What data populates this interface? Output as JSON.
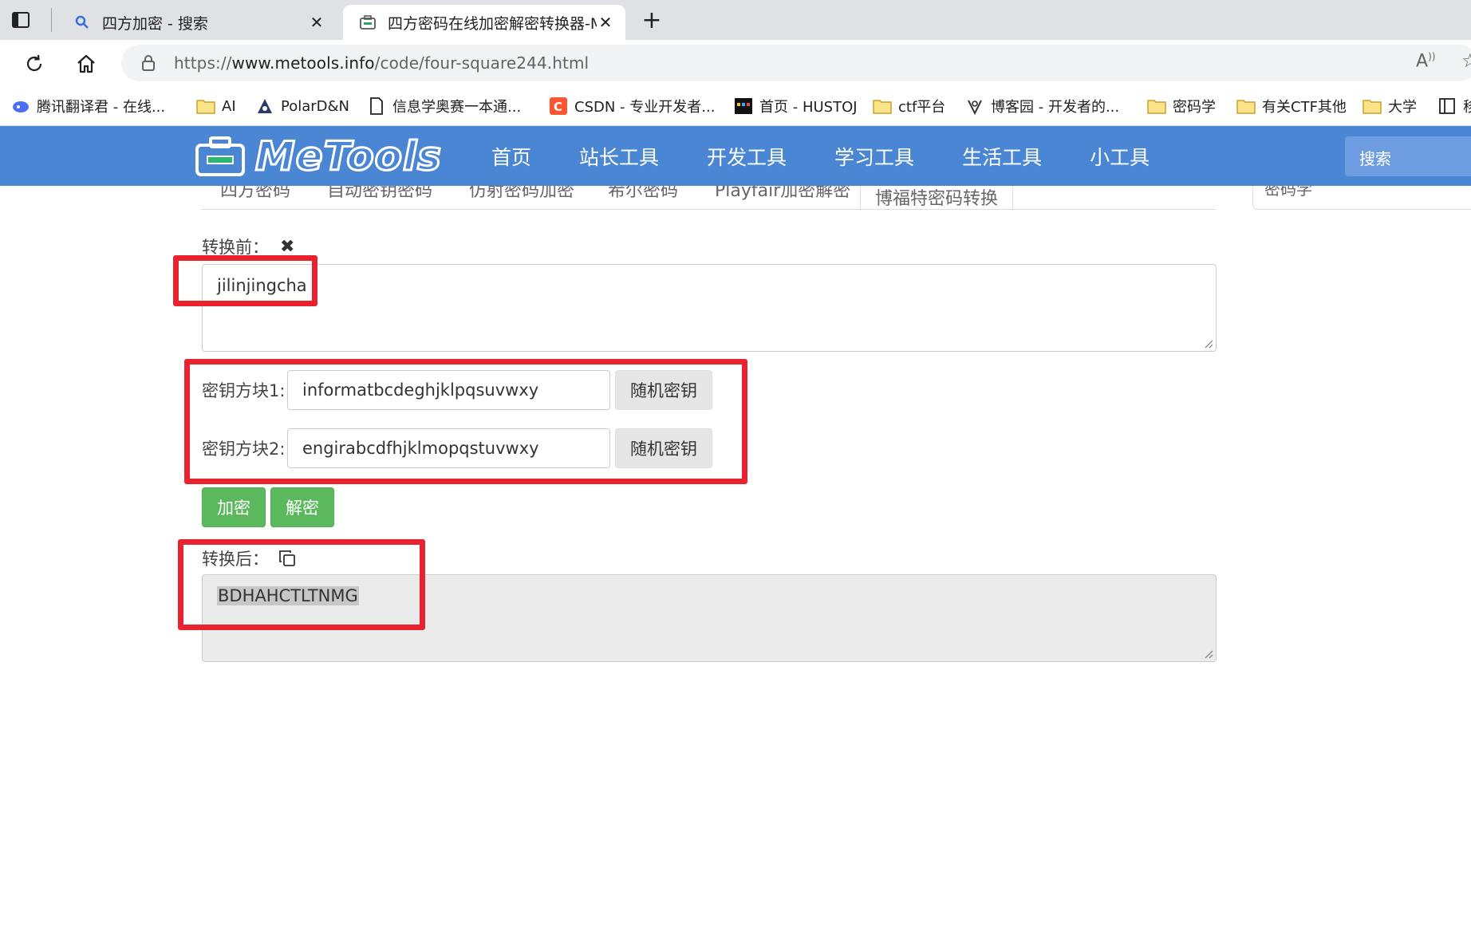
{
  "browser": {
    "tabs": [
      {
        "title": "四方加密 - 搜索",
        "icon": "search-icon",
        "active": false
      },
      {
        "title": "四方密码在线加密解密转换器-Me",
        "icon": "metools-favicon",
        "active": true
      }
    ],
    "new_tab": "+",
    "url_prefix": "https://",
    "url_host": "www.metools.info",
    "url_path": "/code/four-square244.html"
  },
  "bookmarks": [
    {
      "label": "腾讯翻译君 - 在线...",
      "icon": "translate-icon"
    },
    {
      "label": "AI",
      "icon": "folder-icon"
    },
    {
      "label": "PolarD&N",
      "icon": "polar-icon"
    },
    {
      "label": "信息学奥赛一本通...",
      "icon": "page-icon"
    },
    {
      "label": "CSDN - 专业开发者...",
      "icon": "csdn-icon"
    },
    {
      "label": "首页 - HUSTOJ",
      "icon": "hustoj-icon"
    },
    {
      "label": "ctf平台",
      "icon": "folder-icon"
    },
    {
      "label": "博客园 - 开发者的...",
      "icon": "cnblogs-icon"
    },
    {
      "label": "密码学",
      "icon": "folder-icon"
    },
    {
      "label": "有关CTF其他",
      "icon": "folder-icon"
    },
    {
      "label": "大学",
      "icon": "folder-icon"
    },
    {
      "label": "移",
      "icon": "reading-icon"
    }
  ],
  "site": {
    "logo_text": "MeTools",
    "nav": [
      "首页",
      "站长工具",
      "开发工具",
      "学习工具",
      "生活工具",
      "小工具"
    ],
    "search_placeholder": "搜索"
  },
  "subtabs": [
    "四方密码",
    "自动密钥密码",
    "仿射密码加密",
    "希尔密码",
    "Playfair加密解密",
    "博福特密码转换"
  ],
  "side_card_text": "密码学",
  "form": {
    "input_label": "转换前：",
    "input_value": "jilinjingcha",
    "key1_label": "密钥方块1:",
    "key1_value": "informatbcdeghjklpqsuvwxy",
    "key2_label": "密钥方块2:",
    "key2_value": "engirabcdfhjklmopqstuvwxy",
    "random_key_label": "随机密钥",
    "encrypt_label": "加密",
    "decrypt_label": "解密",
    "output_label": "转换后：",
    "output_value": "BDHAHCTLTNMG"
  },
  "colors": {
    "header_blue": "#4a86d4",
    "button_green": "#5cb85c",
    "annotation_red": "#e8222e"
  }
}
